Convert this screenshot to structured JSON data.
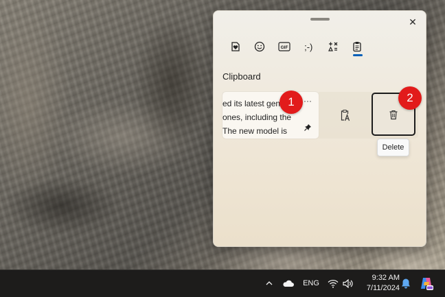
{
  "clipboard_panel": {
    "close_glyph": "✕",
    "tabs": [
      {
        "name": "favorites",
        "icon": "heart-note-icon"
      },
      {
        "name": "emoji",
        "icon": "smiley-icon"
      },
      {
        "name": "gif",
        "icon": "gif-icon",
        "label": "GIF"
      },
      {
        "name": "kaomoji",
        "icon": "kaomoji-icon",
        "label": ";-)"
      },
      {
        "name": "symbols",
        "icon": "symbols-icon"
      },
      {
        "name": "clipboard",
        "icon": "clipboard-icon",
        "active": true
      }
    ],
    "section_title": "Clipboard",
    "item": {
      "lines": [
        "ed its latest gen",
        "ones, including the",
        "The new model is"
      ],
      "more_label": "···"
    },
    "tooltip": "Delete"
  },
  "markers": {
    "first": "1",
    "second": "2"
  },
  "taskbar": {
    "language": "ENG",
    "time": "9:32 AM",
    "date": "7/11/2024"
  },
  "colors": {
    "accent": "#005fb8",
    "marker": "#e21b1b",
    "taskbar": "#1d1c1b"
  }
}
